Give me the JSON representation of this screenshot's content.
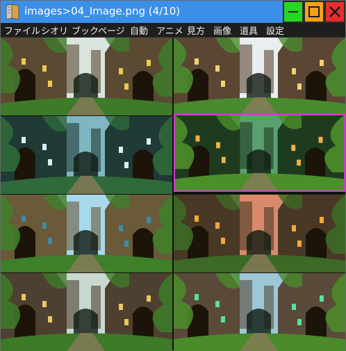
{
  "window": {
    "title": "images>04_Image.png (4/10)",
    "icon": "book-icon",
    "controls": {
      "minimize": "minimize-icon",
      "maximize": "maximize-icon",
      "close": "close-icon"
    },
    "colors": {
      "titlebar": "#3b8fe9",
      "minimize": "#27d71f",
      "maximize": "#f3a21a",
      "close": "#e52e2e",
      "selection": "#d63ad6"
    }
  },
  "menu": [
    "ファイル",
    "シオリ",
    "ブック",
    "ページ",
    "自動",
    "アニメ",
    "見方",
    "画像",
    "道具",
    "設定"
  ],
  "thumbnails": [
    {
      "name": "thumb-1",
      "sky": "#d8e4dc",
      "wall": "#5a4a32",
      "moss": "#3f7a2a",
      "light": "#f2c84a",
      "selected": false
    },
    {
      "name": "thumb-2",
      "sky": "#e9eef0",
      "wall": "#5a4632",
      "moss": "#4a8a2e",
      "light": "#f0d070",
      "selected": false
    },
    {
      "name": "thumb-3",
      "sky": "#7fb6c2",
      "wall": "#203a36",
      "moss": "#2f6a3a",
      "light": "#d8f0f6",
      "selected": false
    },
    {
      "name": "thumb-4",
      "sky": "#5aa070",
      "wall": "#1f3b1f",
      "moss": "#4c8f2a",
      "light": "#f0b04a",
      "selected": true
    },
    {
      "name": "thumb-5",
      "sky": "#a8d8ec",
      "wall": "#6a5a3a",
      "moss": "#3f7f2a",
      "light": "#3e8aa8",
      "selected": false
    },
    {
      "name": "thumb-6",
      "sky": "#d88a6a",
      "wall": "#4a3826",
      "moss": "#3c6a26",
      "light": "#f2a83a",
      "selected": false
    },
    {
      "name": "thumb-7",
      "sky": "#c9d8d0",
      "wall": "#4e4030",
      "moss": "#3d7a28",
      "light": "#e8c860",
      "selected": false
    },
    {
      "name": "thumb-8",
      "sky": "#9cc8d8",
      "wall": "#5a4a3a",
      "moss": "#4a8a2a",
      "light": "#58e0a0",
      "selected": false
    }
  ]
}
